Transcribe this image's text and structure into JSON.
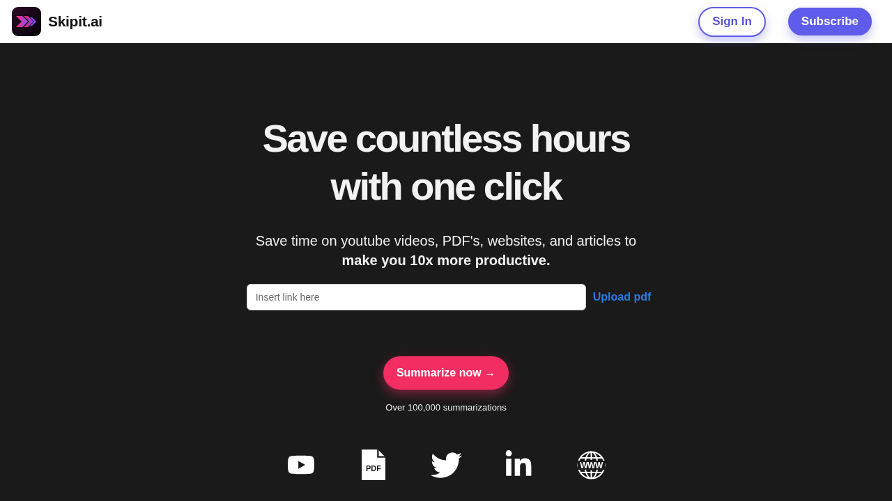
{
  "header": {
    "brand": "Skipit.ai",
    "buttons": [
      {
        "label": "Sign In",
        "kind": "outline"
      },
      {
        "label": "Subscribe",
        "kind": "filled"
      }
    ]
  },
  "hero": {
    "title_lines": [
      "Save countless hours",
      "with one click"
    ],
    "subtitle": "Save time on youtube videos, PDF's, websites, and articles to **make you 10x more productive.**"
  },
  "link_input": {
    "placeholder": "Insert link here"
  },
  "upload_link": "Upload pdf",
  "cta": {
    "label": "Summarize now →"
  },
  "stat": "Over 100,000 summarizations",
  "sources": [
    {
      "kind": "youtube"
    },
    {
      "kind": "pdf",
      "label": "PDF"
    },
    {
      "kind": "twitter"
    },
    {
      "kind": "linkedin"
    },
    {
      "kind": "web",
      "label": "WWW"
    }
  ]
}
